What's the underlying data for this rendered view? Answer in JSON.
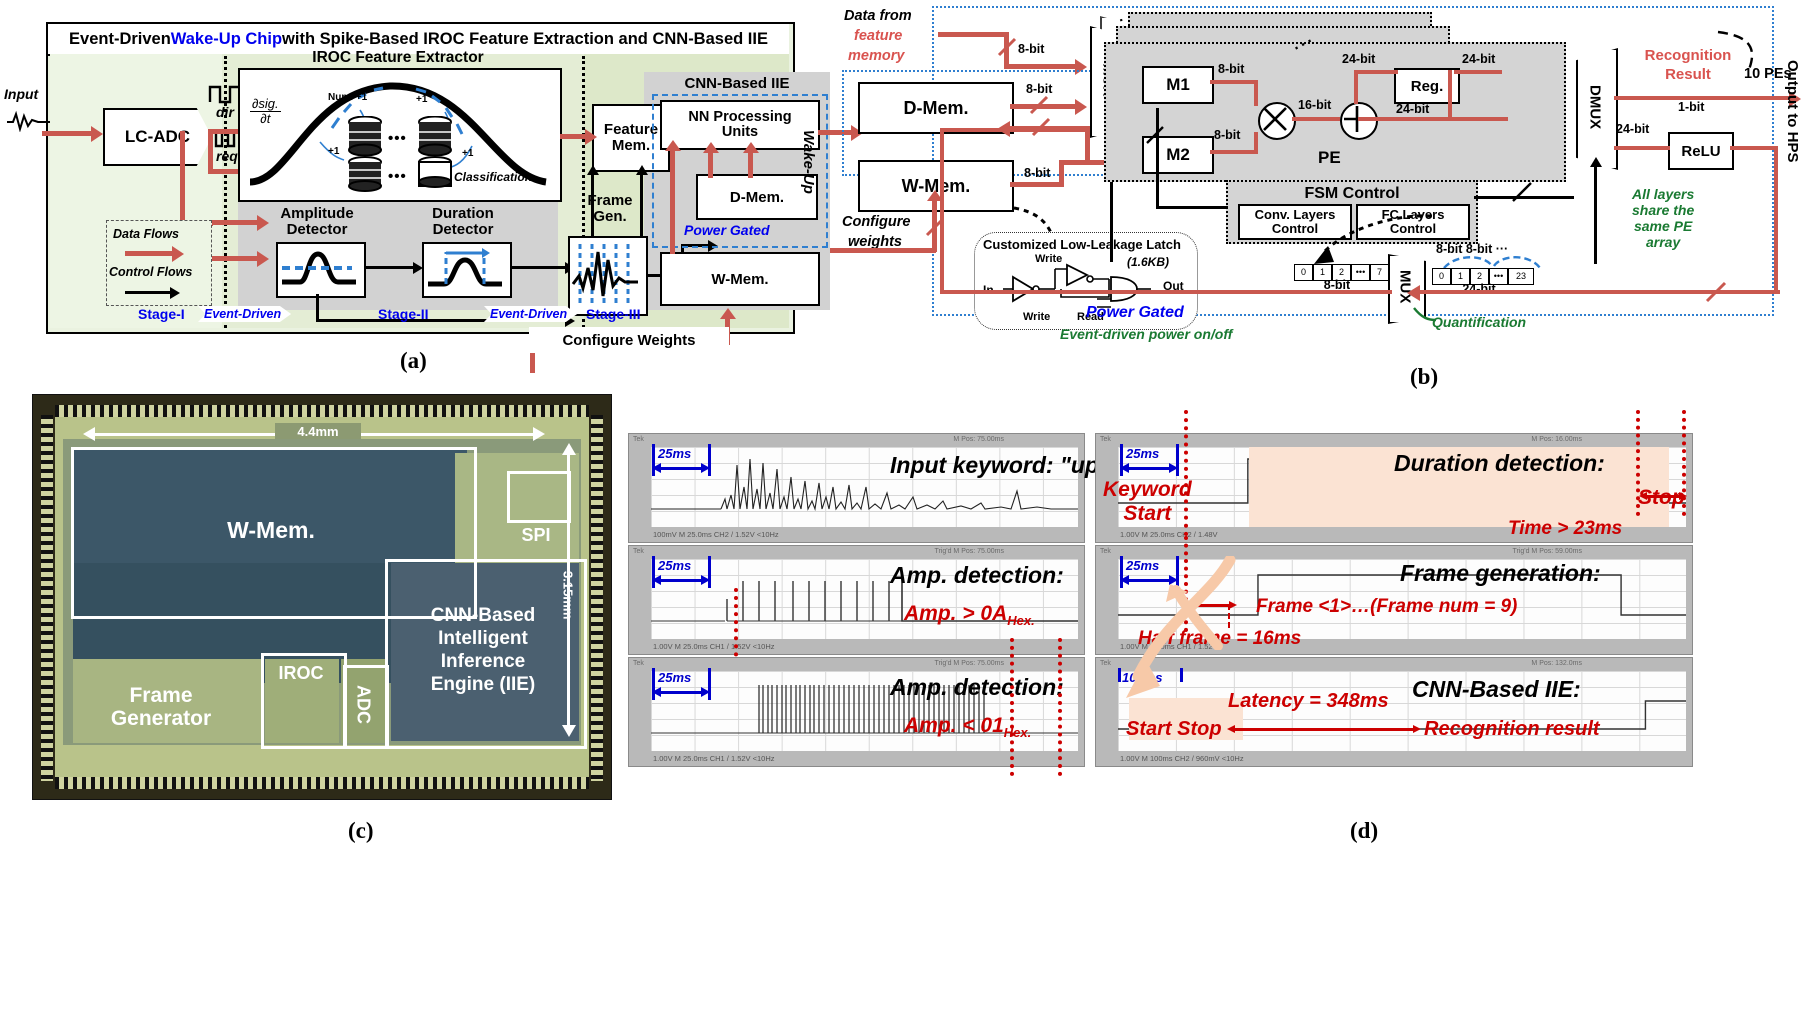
{
  "panel_a": {
    "caption": "(a)",
    "title_parts": {
      "pre": "Event-Driven ",
      "highlight": "Wake-Up Chip",
      "post": " with Spike-Based IROC Feature Extraction and CNN-Based IIE"
    },
    "input_label": "Input",
    "lc_adc": "LC-ADC",
    "signals": {
      "dir": "dir",
      "req": "req"
    },
    "iroc_title": "IROC Feature Extractor",
    "iroc_inner": {
      "derivative": "∂sig.",
      "derivative_den": "∂t",
      "num_plus": "Num. +1",
      "plus1": "+1",
      "classification": "Classification",
      "dots": "•••"
    },
    "amplitude_detector": "Amplitude\nDetector",
    "duration_detector": "Duration\nDetector",
    "legend": {
      "data_flows": "Data Flows",
      "control_flows": "Control Flows"
    },
    "feature_mem": "Feature\nMem.",
    "frame_gen": "Frame\nGen.",
    "cnn_title": "CNN-Based  IIE",
    "nn_units": "NN Processing\nUnits",
    "d_mem": "D-Mem.",
    "power_gated": "Power Gated",
    "w_mem": "W-Mem.",
    "wake_up": "Wake-Up",
    "configure_weights": "Configure Weights",
    "stages": [
      "Stage-I",
      "Stage-II",
      "Stage-III"
    ],
    "event_driven": "Event-Driven"
  },
  "panel_b": {
    "caption": "(b)",
    "data_from": {
      "line1": "Data from",
      "line2": "feature",
      "line3": "memory"
    },
    "d_mem": "D-Mem.",
    "w_mem": "W-Mem.",
    "configure_weights": {
      "line1": "Configure",
      "line2": "weights"
    },
    "latch": {
      "title": "Customized Low-Leakage Latch",
      "size": "(1.6KB)",
      "in": "In",
      "out": "Out",
      "write": "Write",
      "write2": "Write",
      "read": "Read"
    },
    "mux": "MUX",
    "dmux": "DMUX",
    "mux2": "MUX",
    "m1": "M1",
    "m2": "M2",
    "reg": "Reg.",
    "relu": "ReLU",
    "pe": "PE",
    "pes_count": "10 PEs",
    "recognition_result": {
      "line1": "Recognition",
      "line2": "Result"
    },
    "output_to_hps": "Output to HPS",
    "fsm_control": "FSM Control",
    "conv_control": "Conv. Layers\nControl",
    "fc_control": "FC Layers\nControl",
    "all_layers_note": "All layers\nshare the\nsame PE\narray",
    "quantification": "Quantification",
    "power_gated": "Power Gated",
    "event_driven_power": "Event-driven power on/off",
    "bit_labels": {
      "b8": "8-bit",
      "b16": "16-bit",
      "b24": "24-bit",
      "b1": "1-bit"
    },
    "bitcells_8": [
      "0",
      "1",
      "2",
      "•••",
      "7"
    ],
    "bitcells_24": [
      "0",
      "1",
      "2",
      "•••",
      "23"
    ],
    "bit8_pair": "8-bit 8-bit ···",
    "width_8": "8-bit",
    "width_24": "24-bit"
  },
  "panel_c": {
    "caption": "(c)",
    "dim_width": "4.4mm",
    "dim_height": "3.15mm",
    "blocks": {
      "w_mem": "W-Mem.",
      "spi": "SPI",
      "frame_generator": "Frame\nGenerator",
      "iroc": "IROC",
      "adc": "ADC",
      "iie": "CNN-Based\nIntelligent\nInference\nEngine (IIE)"
    }
  },
  "panel_d": {
    "caption": "(d)",
    "scopes": [
      {
        "id": "input-keyword",
        "time_marker": "25ms",
        "title": "Input keyword: \"up\"",
        "top_status": "M Pos: 75.00ms",
        "bottom_status": "100mV                                              M 25.0ms            CH2 / 1.52V        <10Hz"
      },
      {
        "id": "amp-detection-high",
        "time_marker": "25ms",
        "title": "Amp. detection:",
        "annotation": "Amp. > 0A",
        "annotation_sub": "Hex.",
        "top_status": "Trig'd                 M Pos: 75.00ms",
        "bottom_status": "1.00V                                                M 25.0ms            CH1 / 1.52V        <10Hz"
      },
      {
        "id": "amp-detection-low",
        "time_marker": "25ms",
        "title": "Amp. detection:",
        "annotation": "Amp. < 01",
        "annotation_sub": "Hex.",
        "top_status": "Trig'd                 M Pos: 75.00ms",
        "bottom_status": "1.00V                                                M 25.0ms            CH1 / 1.52V        <10Hz"
      },
      {
        "id": "duration-detection",
        "time_marker": "25ms",
        "title": "Duration detection:",
        "label_start": "Keyword\nStart",
        "label_stop": "Stop",
        "annotation": "Time > 23ms",
        "top_status": "M Pos: 16.00ms",
        "bottom_status": "1.00V                                                M 25.0ms            CH2 / 1.48V"
      },
      {
        "id": "frame-generation",
        "time_marker": "25ms",
        "title": "Frame generation:",
        "annotation": "Frame <1>…(Frame num = 9)",
        "annotation2": "Half frame = 16ms",
        "top_status": "Trig'd                 M Pos: 59.00ms",
        "bottom_status": "1.00V                                                M 25.0ms            CH1 / 1.52V"
      },
      {
        "id": "cnn-based-iie",
        "time_marker": "100ms",
        "title": "CNN-Based IIE:",
        "label_start_stop": "Start  Stop",
        "annotation": "Latency = 348ms",
        "annotation2": "Recognition result",
        "top_status": "M Pos: 132.0ms",
        "bottom_status": "1.00V                                                M 100ms             CH2 / 960mV        <10Hz"
      }
    ]
  },
  "colors": {
    "data_flow_red": "#c9584f",
    "blue_accent": "#0000ee",
    "green_note": "#1a7a32",
    "red_annotation": "#cc0000",
    "power_gate_blue": "#2f7fd0"
  }
}
